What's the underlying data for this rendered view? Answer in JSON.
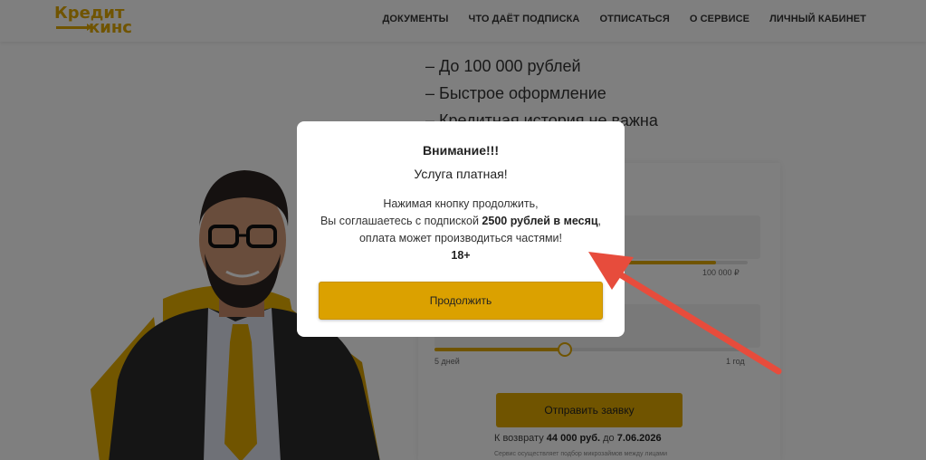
{
  "header": {
    "logo_line1": "Кредит",
    "logo_line2": "кинс",
    "nav": [
      "ДОКУМЕНТЫ",
      "ЧТО ДАЁТ ПОДПИСКА",
      "ОТПИСАТЬСЯ",
      "О СЕРВИСЕ",
      "ЛИЧНЫЙ КАБИНЕТ"
    ]
  },
  "hero": {
    "bullets": [
      "– До 100 000 рублей",
      "– Быстрое оформление",
      "– Кредитная история не важна"
    ]
  },
  "form": {
    "amount_max_label": "100 000 ₽",
    "term_min_label": "5 дней",
    "term_max_label": "1 год",
    "submit_label": "Отправить заявку",
    "return_prefix": "К возврату",
    "return_amount": "44 000 руб.",
    "return_mid": "до",
    "return_date": "7.06.2026",
    "fine_print": "Сервис осуществляет подбор микрозаймов между лицами"
  },
  "modal": {
    "title": "Внимание!!!",
    "subtitle": "Услуга платная!",
    "line1": "Нажимая кнопку продолжить,",
    "line2_pre": "Вы соглашаетесь с подпиской",
    "line2_bold": "2500 рублей в месяц",
    "line2_post": ", оплата может производиться частями!",
    "age": "18+",
    "continue_label": "Продолжить"
  },
  "colors": {
    "accent": "#e0a800",
    "arrow": "#e74c3c",
    "overlay": "rgba(0,0,0,0.5)"
  }
}
